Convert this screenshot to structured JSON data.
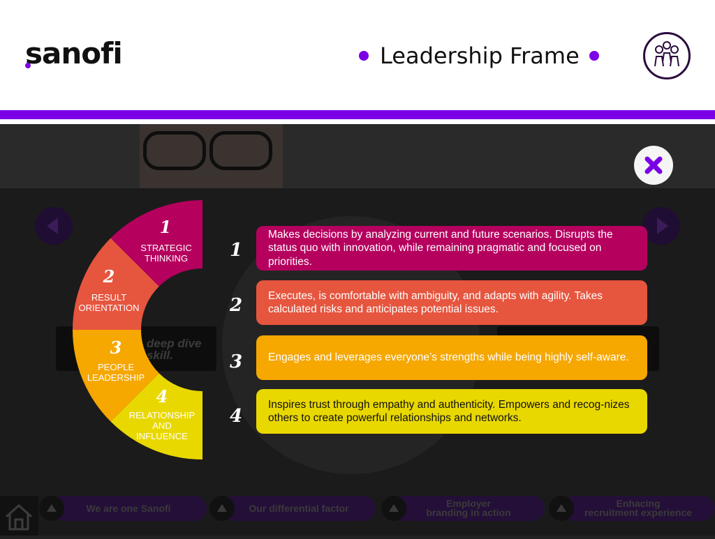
{
  "header": {
    "logo": "sanofi",
    "title": "Leadership Frame"
  },
  "background": {
    "ghost_card_text": "deep dive\nskill."
  },
  "wheel": {
    "segments": [
      {
        "number": "1",
        "label": "STRATEGIC\nTHINKING",
        "color": "#b5005e"
      },
      {
        "number": "2",
        "label": "RESULT\nORIENTATION",
        "color": "#e6553e"
      },
      {
        "number": "3",
        "label": "PEOPLE\nLEADERSHIP",
        "color": "#f6a700"
      },
      {
        "number": "4",
        "label": "RELATIONSHIP\nAND\nINFLUENCE",
        "color": "#e9d800"
      }
    ]
  },
  "descriptions": [
    {
      "number": "1",
      "text": "Makes decisions by analyzing current and future scenarios. Disrupts the status quo with innovation, while remaining pragmatic and focused on priorities.",
      "color": "#b5005e"
    },
    {
      "number": "2",
      "text": "Executes, is comfortable with ambiguity, and adapts with agility. Takes calculated risks and anticipates potential issues.",
      "color": "#e6553e"
    },
    {
      "number": "3",
      "text": "Engages and leverages everyone’s strengths while being highly self-aware.",
      "color": "#f6a700"
    },
    {
      "number": "4",
      "text": "Inspires trust through empathy and authenticity. Empowers and recog-nizes others to create powerful relationships and networks.",
      "color": "#e9d800"
    }
  ],
  "bottom_nav": {
    "items": [
      "We are one Sanofi",
      "Our differential factor",
      "Employer\nbranding in action",
      "Enhacing\nrecruitment experience"
    ]
  },
  "colors": {
    "accent": "#7a00e6"
  },
  "icons": [
    "close-icon",
    "arrow-left-icon",
    "arrow-right-icon",
    "home-icon",
    "leadership-badge-icon",
    "triangle-up-icon"
  ]
}
